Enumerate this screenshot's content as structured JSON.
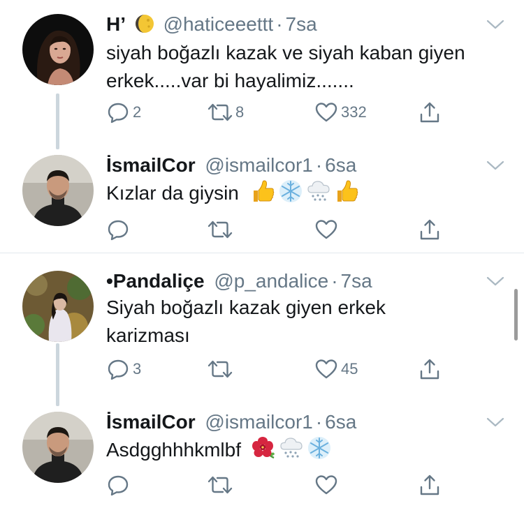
{
  "tweets": [
    {
      "name": "H’",
      "handle": "@haticeeettt",
      "sep": "·",
      "time": "7sa",
      "text": "siyah boğazlı kazak ve siyah kaban giyen erkek.....var bi hayalimiz.......",
      "reply_count": "2",
      "retweet_count": "8",
      "like_count": "332"
    },
    {
      "name": "İsmailCor",
      "handle": "@ismailcor1",
      "sep": "·",
      "time": "6sa",
      "text": "Kızlar da giysin",
      "emojis": [
        "thumbs-up",
        "snowflake",
        "cloud-snow",
        "thumbs-up"
      ]
    },
    {
      "name": "•Pandaliçe",
      "handle": "@p_andalice",
      "sep": "·",
      "time": "7sa",
      "text": "Siyah boğazlı kazak giyen erkek karizması",
      "reply_count": "3",
      "retweet_count": "",
      "like_count": "45"
    },
    {
      "name": "İsmailCor",
      "handle": "@ismailcor1",
      "sep": "·",
      "time": "6sa",
      "text": "Asdgghhhkmlbf",
      "emojis": [
        "hibiscus",
        "cloud-snow",
        "snowflake"
      ]
    }
  ],
  "icons": {
    "reply": "reply-icon",
    "retweet": "retweet-icon",
    "like": "heart-icon",
    "share": "share-icon",
    "menu": "chevron-down-icon"
  },
  "colors": {
    "text": "#14171a",
    "secondary": "#657786",
    "thread_line": "#ccd6dd",
    "divider": "#e1e8ed"
  }
}
